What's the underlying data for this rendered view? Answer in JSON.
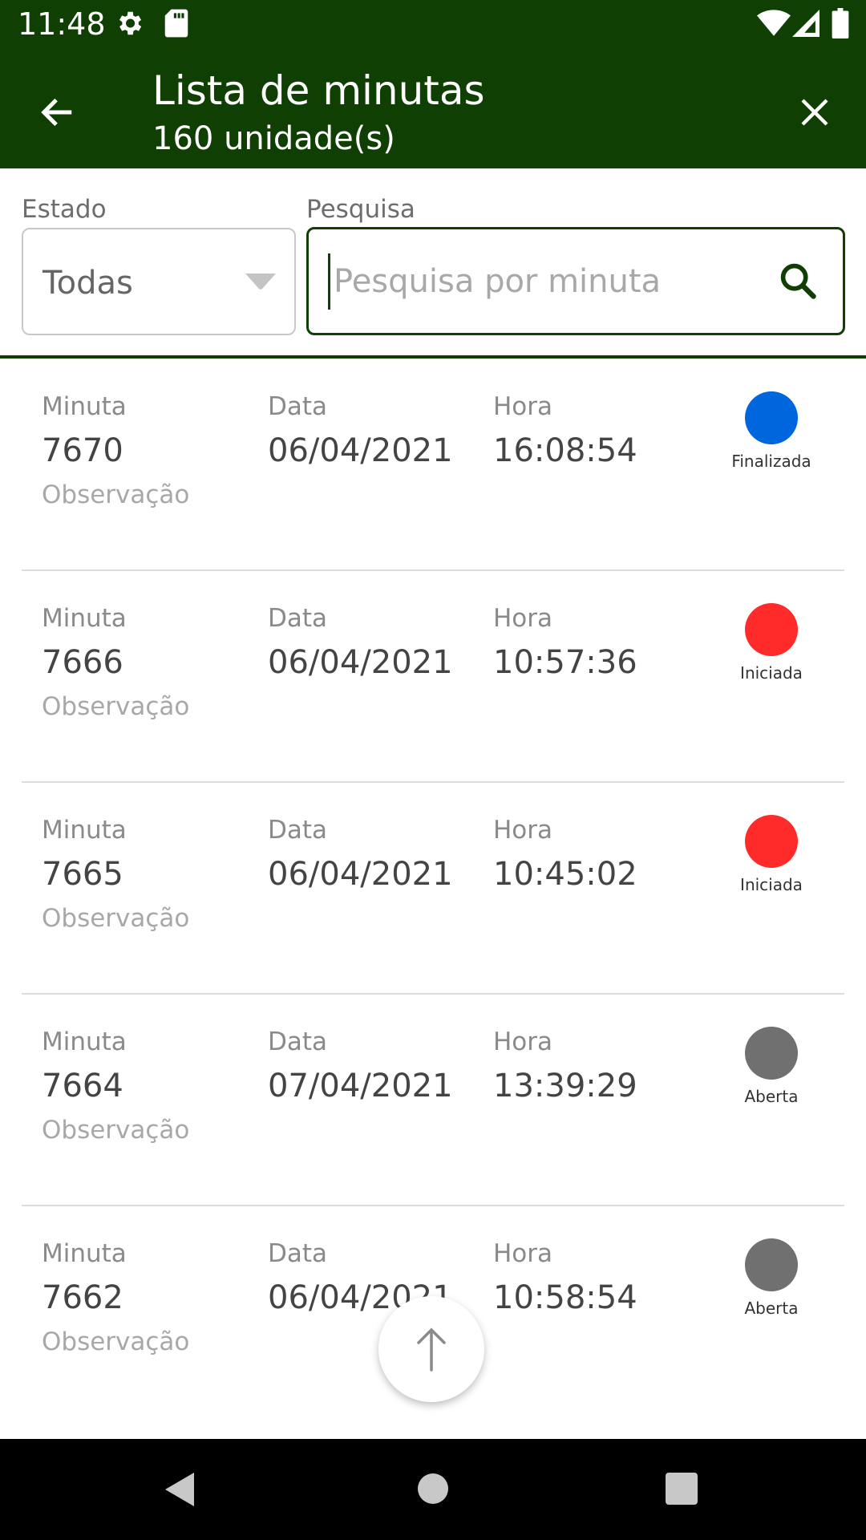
{
  "status_bar": {
    "time": "11:48"
  },
  "header": {
    "title": "Lista de minutas",
    "subtitle": "160 unidade(s)"
  },
  "filters": {
    "estado_label": "Estado",
    "estado_value": "Todas",
    "pesquisa_label": "Pesquisa",
    "search_placeholder": "Pesquisa por minuta"
  },
  "columns": {
    "minuta": "Minuta",
    "data": "Data",
    "hora": "Hora",
    "observacao": "Observação"
  },
  "status_colors": {
    "Finalizada": "#0066dd",
    "Iniciada": "#ff2a2a",
    "Aberta": "#707070"
  },
  "items": [
    {
      "minuta": "7670",
      "data": "06/04/2021",
      "hora": "16:08:54",
      "status": "Finalizada"
    },
    {
      "minuta": "7666",
      "data": "06/04/2021",
      "hora": "10:57:36",
      "status": "Iniciada"
    },
    {
      "minuta": "7665",
      "data": "06/04/2021",
      "hora": "10:45:02",
      "status": "Iniciada"
    },
    {
      "minuta": "7664",
      "data": "07/04/2021",
      "hora": "13:39:29",
      "status": "Aberta"
    },
    {
      "minuta": "7662",
      "data": "06/04/2021",
      "hora": "10:58:54",
      "status": "Aberta"
    }
  ]
}
